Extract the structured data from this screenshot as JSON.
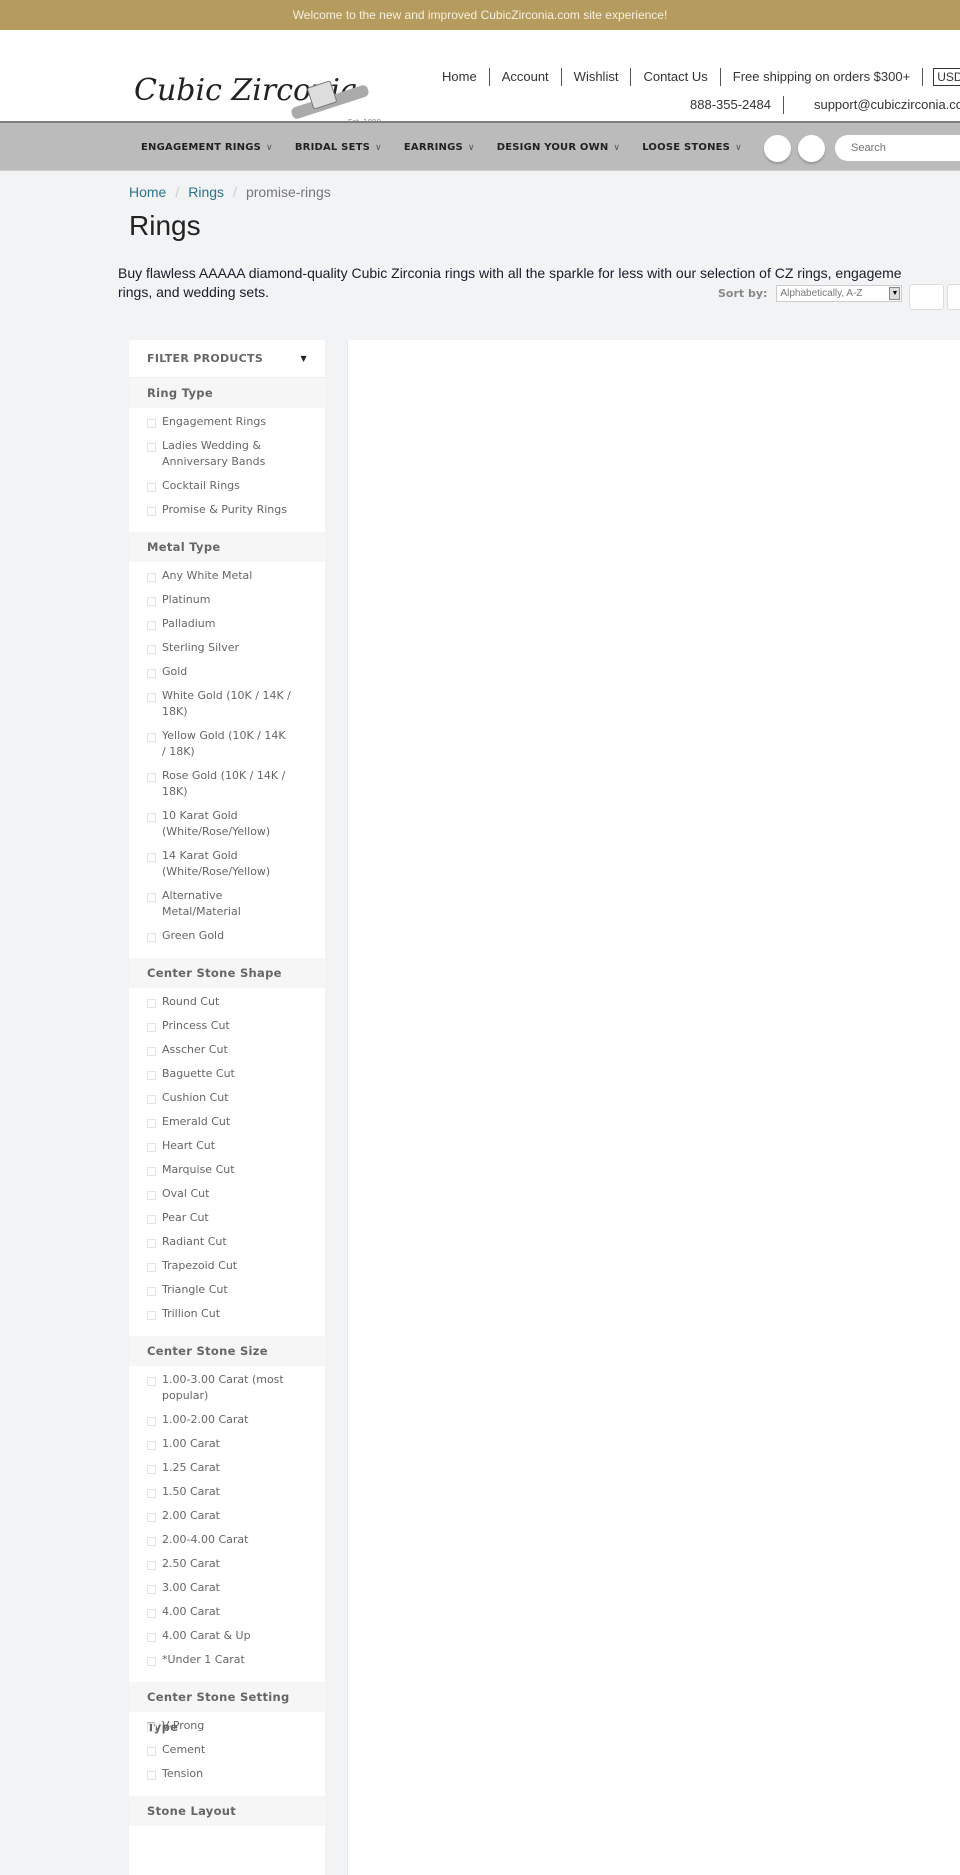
{
  "announcement": "Welcome to the new and improved CubicZirconia.com site experience!",
  "logo": {
    "text": "Cubic Zirconia",
    "est": "Est. 1999"
  },
  "toplinks": [
    "Home",
    "Account",
    "Wishlist",
    "Contact Us",
    "Free shipping on orders $300+"
  ],
  "currency": "USD",
  "contact": {
    "phone": "888-355-2484",
    "email": "support@cubiczirconia.com"
  },
  "nav": [
    {
      "label": "ENGAGEMENT RINGS"
    },
    {
      "label": "BRIDAL SETS"
    },
    {
      "label": "EARRINGS"
    },
    {
      "label": "DESIGN YOUR OWN"
    },
    {
      "label": "LOOSE STONES"
    }
  ],
  "search": {
    "placeholder": "Search"
  },
  "breadcrumb": {
    "home": "Home",
    "rings": "Rings",
    "current": "promise-rings",
    "sep": "/"
  },
  "page_title": "Rings",
  "description": "Buy flawless AAAAA diamond-quality Cubic Zirconia rings with all the sparkle for less with our selection of CZ rings, engagement rings, and wedding sets.",
  "description_line1": "Buy flawless AAAAA diamond-quality Cubic Zirconia rings with all the sparkle for less with our selection of CZ rings, engageme",
  "description_line2": "rings, and wedding sets.",
  "sort": {
    "label": "Sort by:",
    "selected": "Alphabetically, A-Z"
  },
  "filter": {
    "title": "FILTER PRODUCTS",
    "groups": [
      {
        "title": "Ring Type",
        "options": [
          "Engagement Rings",
          "Ladies Wedding & Anniversary Bands",
          "Cocktail Rings",
          "Promise & Purity Rings"
        ]
      },
      {
        "title": "Metal Type",
        "options": [
          "Any White Metal",
          "Platinum",
          "Palladium",
          "Sterling Silver",
          "Gold",
          "White Gold (10K / 14K / 18K)",
          "Yellow Gold (10K / 14K / 18K)",
          "Rose Gold (10K / 14K / 18K)",
          "10 Karat Gold (White/Rose/Yellow)",
          "14 Karat Gold (White/Rose/Yellow)",
          "Alternative Metal/Material",
          "Green Gold"
        ]
      },
      {
        "title": "Center Stone Shape",
        "options": [
          "Round Cut",
          "Princess Cut",
          "Asscher Cut",
          "Baguette Cut",
          "Cushion Cut",
          "Emerald Cut",
          "Heart Cut",
          "Marquise Cut",
          "Oval Cut",
          "Pear Cut",
          "Radiant Cut",
          "Trapezoid Cut",
          "Triangle Cut",
          "Trillion Cut"
        ]
      },
      {
        "title": "Center Stone Size",
        "options": [
          "1.00-3.00 Carat (most popular)",
          "1.00-2.00 Carat",
          "1.00 Carat",
          "1.25 Carat",
          "1.50 Carat",
          "2.00 Carat",
          "2.00-4.00 Carat",
          "2.50 Carat",
          "3.00 Carat",
          "4.00 Carat",
          "4.00 Carat & Up",
          "*Under 1 Carat"
        ]
      },
      {
        "title": "Center Stone Setting Type",
        "options": [
          "V-Prong",
          "Cement",
          "Tension"
        ]
      },
      {
        "title": "Stone Layout",
        "options": []
      }
    ]
  },
  "colors": {
    "announce_bg": "#b59b5d",
    "nav_bg": "#bbbbbb",
    "link": "#2b7387",
    "page_bg": "#f2f3f5"
  }
}
